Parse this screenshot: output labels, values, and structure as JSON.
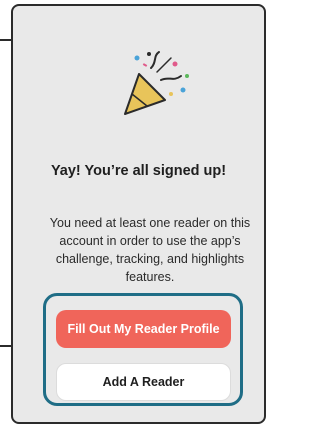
{
  "signup": {
    "title": "Yay! You’re all signed up!",
    "message": "You need at least one reader on this account in order to use the app’s challenge, tracking, and highlights features."
  },
  "buttons": {
    "primary_label": "Fill Out My Reader Profile",
    "secondary_label": "Add A Reader"
  },
  "icons": {
    "celebration": "party-popper-icon"
  },
  "colors": {
    "primary_button": "#f0655a",
    "highlight_outline": "#1f6d86",
    "panel_background": "#e9e9e9"
  }
}
